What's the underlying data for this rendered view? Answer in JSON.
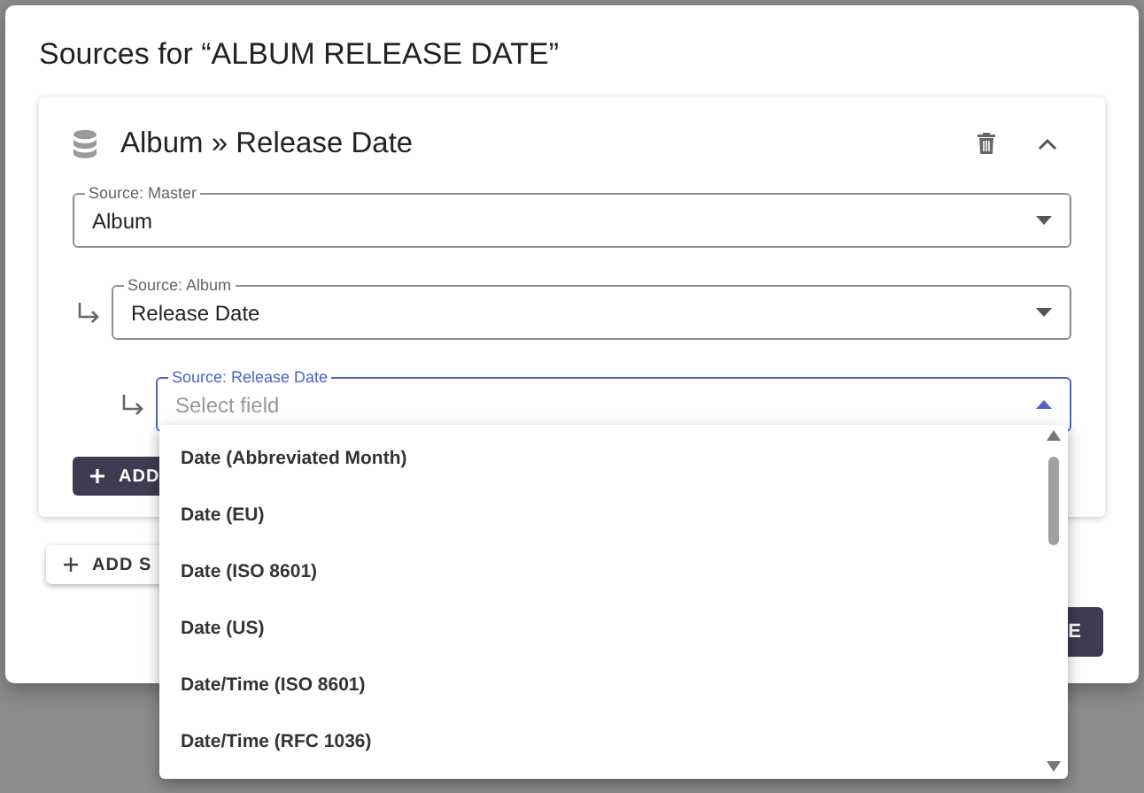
{
  "dialog": {
    "title": "Sources for “ALBUM RELEASE DATE”",
    "source": {
      "title": "Album » Release Date",
      "expanded": true,
      "fields": [
        {
          "label": "Source: Master",
          "value": "Album",
          "focused": false
        },
        {
          "label": "Source: Album",
          "value": "Release Date",
          "focused": false
        },
        {
          "label": "Source: Release Date",
          "placeholder": "Select field",
          "focused": true
        }
      ],
      "add_button": "ADD"
    },
    "add_source_button": "ADD S",
    "save_button": "E"
  },
  "dropdown": {
    "items": [
      {
        "label": "Date (Abbreviated Month)"
      },
      {
        "label": "Date (EU)"
      },
      {
        "label": "Date (ISO 8601)"
      },
      {
        "label": "Date (US)"
      },
      {
        "label": "Date/Time (ISO 8601)"
      },
      {
        "label": "Date/Time (RFC 1036)"
      }
    ]
  }
}
